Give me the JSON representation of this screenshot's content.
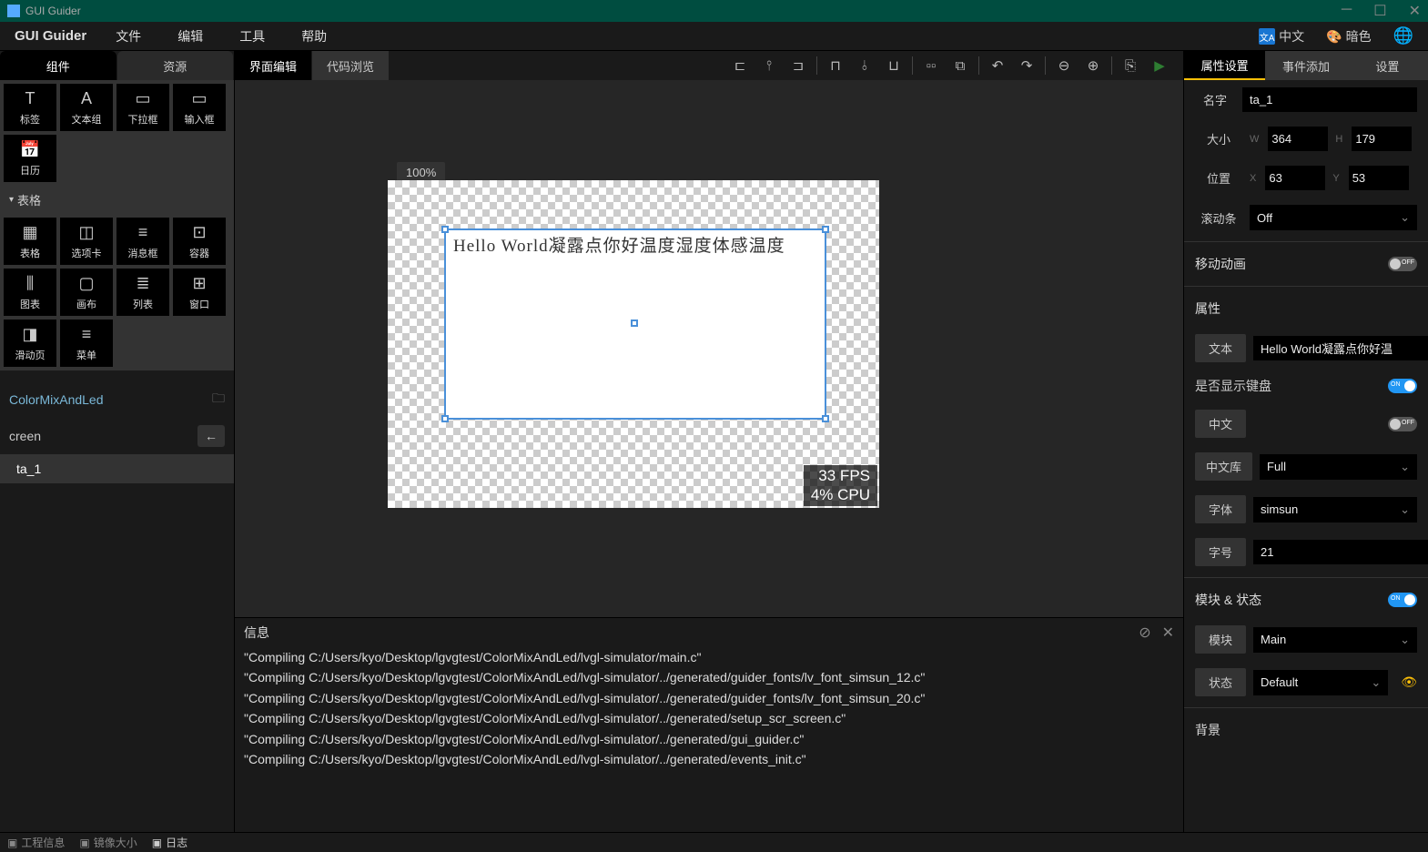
{
  "titlebar": {
    "title": "GUI Guider"
  },
  "menubar": {
    "app": "GUI Guider",
    "items": [
      "文件",
      "编辑",
      "工具",
      "帮助"
    ],
    "lang": "中文",
    "theme": "暗色"
  },
  "left": {
    "tabs": [
      "组件",
      "资源"
    ],
    "widgets1": [
      {
        "icon": "T",
        "label": "标签"
      },
      {
        "icon": "A",
        "label": "文本组"
      },
      {
        "icon": "▭",
        "label": "下拉框"
      },
      {
        "icon": "▭",
        "label": "输入框"
      },
      {
        "icon": "📅",
        "label": "日历"
      }
    ],
    "section": "表格",
    "widgets2": [
      {
        "icon": "▦",
        "label": "表格"
      },
      {
        "icon": "◫",
        "label": "选项卡"
      },
      {
        "icon": "≡",
        "label": "消息框"
      },
      {
        "icon": "⊡",
        "label": "容器"
      },
      {
        "icon": "⫼",
        "label": "图表"
      },
      {
        "icon": "▢",
        "label": "画布"
      },
      {
        "icon": "≣",
        "label": "列表"
      },
      {
        "icon": "⊞",
        "label": "窗口"
      },
      {
        "icon": "◨",
        "label": "滑动页"
      },
      {
        "icon": "≡",
        "label": "菜单"
      }
    ],
    "project": "ColorMixAndLed",
    "screen": "creen",
    "tree_item": "ta_1"
  },
  "center": {
    "tabs": [
      "界面编辑",
      "代码浏览"
    ],
    "zoom": "100%",
    "textarea_content": "Hello World凝露点你好温度湿度体感温度",
    "stats_fps": "33 FPS",
    "stats_cpu": "4% CPU"
  },
  "info": {
    "title": "信息",
    "lines": [
      "\"Compiling C:/Users/kyo/Desktop/lgvgtest/ColorMixAndLed/lvgl-simulator/main.c\"",
      "\"Compiling C:/Users/kyo/Desktop/lgvgtest/ColorMixAndLed/lvgl-simulator/../generated/guider_fonts/lv_font_simsun_12.c\"",
      "\"Compiling C:/Users/kyo/Desktop/lgvgtest/ColorMixAndLed/lvgl-simulator/../generated/guider_fonts/lv_font_simsun_20.c\"",
      "\"Compiling C:/Users/kyo/Desktop/lgvgtest/ColorMixAndLed/lvgl-simulator/../generated/setup_scr_screen.c\"",
      "\"Compiling C:/Users/kyo/Desktop/lgvgtest/ColorMixAndLed/lvgl-simulator/../generated/gui_guider.c\"",
      "\"Compiling C:/Users/kyo/Desktop/lgvgtest/ColorMixAndLed/lvgl-simulator/../generated/events_init.c\""
    ]
  },
  "right": {
    "tabs": [
      "属性设置",
      "事件添加",
      "设置"
    ],
    "name_label": "名字",
    "name_value": "ta_1",
    "size_label": "大小",
    "w_prefix": "W",
    "w_value": "364",
    "h_prefix": "H",
    "h_value": "179",
    "pos_label": "位置",
    "x_prefix": "X",
    "x_value": "63",
    "y_prefix": "Y",
    "y_value": "53",
    "scroll_label": "滚动条",
    "scroll_value": "Off",
    "anim_label": "移动动画",
    "attr_label": "属性",
    "text_label": "文本",
    "text_value": "Hello World凝露点你好温",
    "keyboard_label": "是否显示键盘",
    "cn_label": "中文",
    "cnlib_label": "中文库",
    "cnlib_value": "Full",
    "font_label": "字体",
    "font_value": "simsun",
    "fontsize_label": "字号",
    "fontsize_value": "21",
    "module_section": "模块 & 状态",
    "module_label": "模块",
    "module_value": "Main",
    "state_label": "状态",
    "state_value": "Default",
    "bg_label": "背景"
  },
  "statusbar": {
    "items": [
      "工程信息",
      "镜像大小",
      "日志"
    ]
  }
}
